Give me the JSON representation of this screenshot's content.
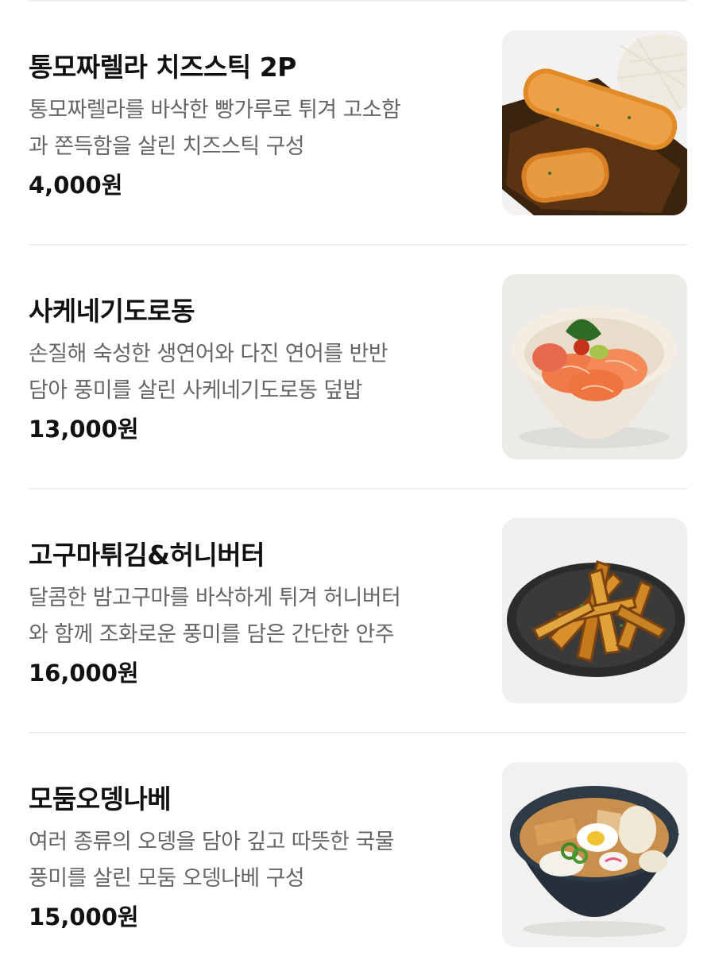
{
  "menu": {
    "items": [
      {
        "name": "통모짜렐라 치즈스틱 2P",
        "desc_line1": "통모짜렐라를 바삭한 빵가루로 튀겨 고소함",
        "desc_line2": "과 쫀득함을 살린 치즈스틱 구성",
        "price": "4,000원",
        "image_icon": "fried-cheese-stick-photo"
      },
      {
        "name": "사케네기도로동",
        "desc_line1": "손질해 숙성한 생연어와 다진 연어를 반반",
        "desc_line2": "담아 풍미를 살린 사케네기도로동 덮밥",
        "price": "13,000원",
        "image_icon": "salmon-rice-bowl-photo"
      },
      {
        "name": "고구마튀김&허니버터",
        "desc_line1": "달콤한 밤고구마를 바삭하게 튀겨 허니버터",
        "desc_line2": "와 함께 조화로운 풍미를 담은 간단한 안주",
        "price": "16,000원",
        "image_icon": "sweet-potato-fries-photo"
      },
      {
        "name": "모둠오뎅나베",
        "desc_line1": "여러 종류의 오뎅을 담아 깊고 따뜻한 국물",
        "desc_line2": "풍미를 살린 모둠 오뎅나베 구성",
        "price": "15,000원",
        "image_icon": "oden-hotpot-photo"
      }
    ]
  }
}
